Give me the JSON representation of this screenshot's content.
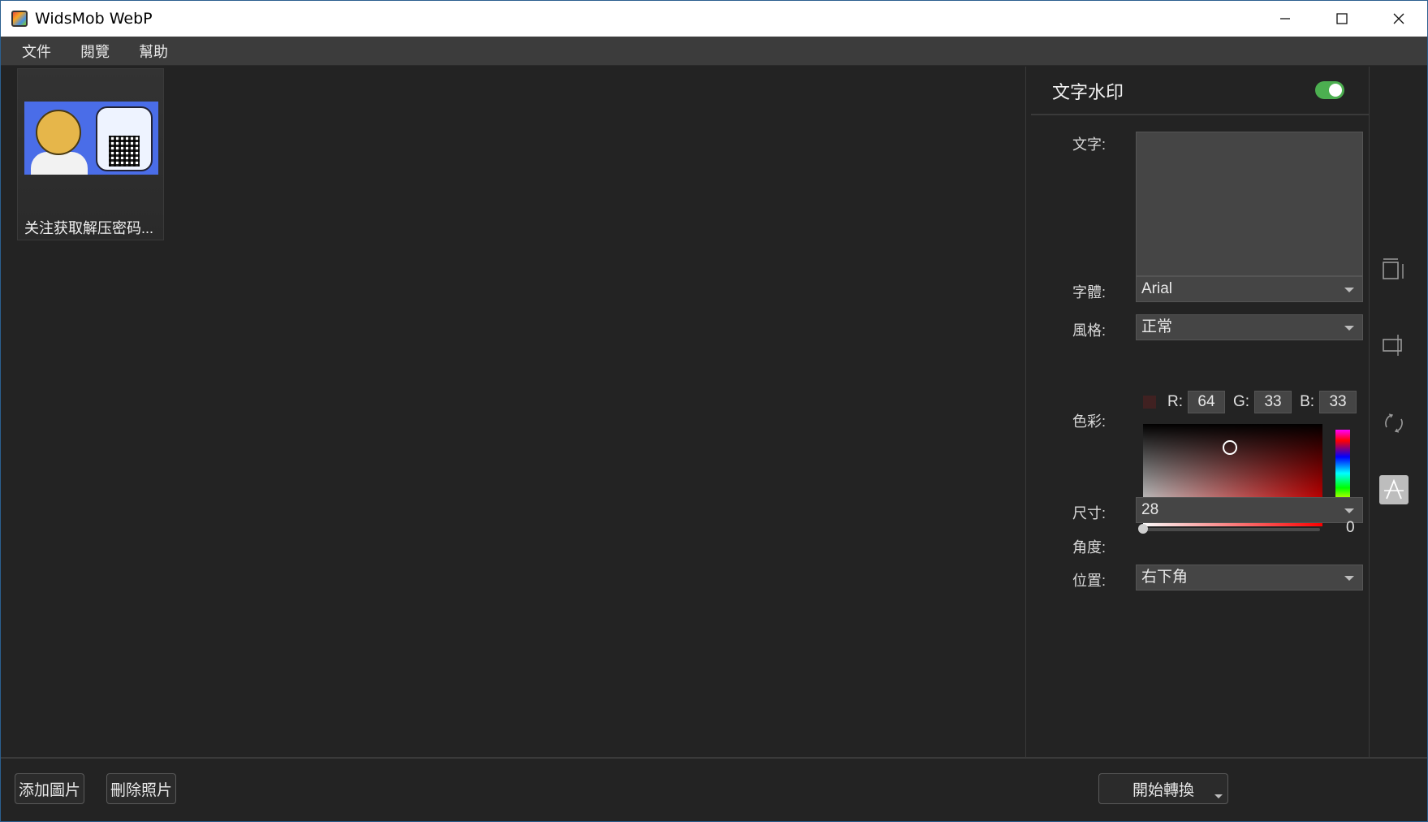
{
  "app": {
    "title": "WidsMob WebP"
  },
  "menu": {
    "items": [
      "文件",
      "閱覽",
      "幫助"
    ]
  },
  "thumbnails": [
    {
      "label": "关注获取解压密码..."
    }
  ],
  "panel": {
    "title": "文字水印",
    "toggle_on": true,
    "text_label": "文字:",
    "text_value": "",
    "font_label": "字體:",
    "font_value": "Arial",
    "style_label": "風格:",
    "style_value": "正常",
    "color_label": "色彩:",
    "rgb": {
      "r_label": "R:",
      "r": "64",
      "g_label": "G:",
      "g": "33",
      "b_label": "B:",
      "b": "33"
    },
    "swatch_color": "#402121",
    "size_label": "尺寸:",
    "size_value": "28",
    "angle_label": "角度:",
    "angle_value": "0",
    "position_label": "位置:",
    "position_value": "右下角"
  },
  "tools": [
    "crop-resize-icon",
    "resize-icon",
    "rotate-icon",
    "text-watermark-icon"
  ],
  "footer": {
    "add_label": "添加圖片",
    "delete_label": "刪除照片",
    "convert_label": "開始轉換"
  },
  "colors": {
    "accent": "#4caf50",
    "background": "#232323",
    "panel_input": "#454545"
  }
}
